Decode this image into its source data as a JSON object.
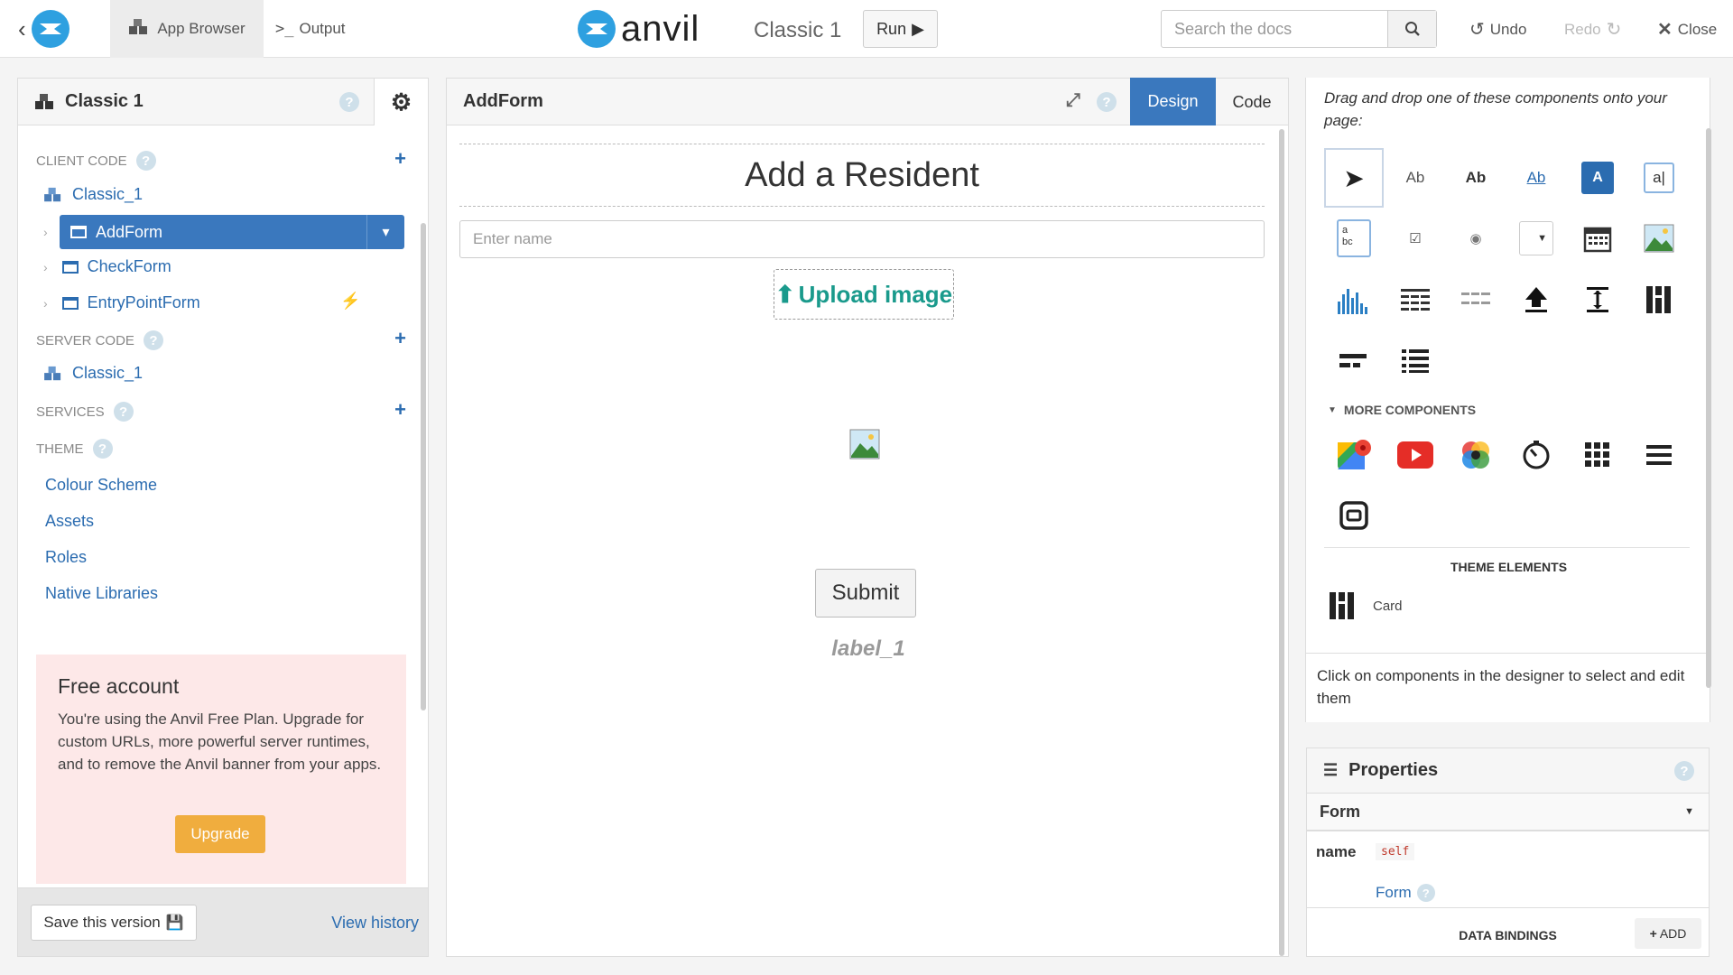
{
  "topbar": {
    "app_browser": "App Browser",
    "output": "Output",
    "brand": "anvil",
    "app_title": "Classic 1",
    "run": "Run",
    "search_placeholder": "Search the docs",
    "undo": "Undo",
    "redo": "Redo",
    "close": "Close"
  },
  "left": {
    "title": "Classic 1",
    "client_code": "CLIENT CODE",
    "client_module": "Classic_1",
    "forms": [
      "AddForm",
      "CheckForm",
      "EntryPointForm"
    ],
    "server_code": "SERVER CODE",
    "server_module": "Classic_1",
    "services": "SERVICES",
    "theme": "THEME",
    "theme_items": [
      "Colour Scheme",
      "Assets",
      "Roles",
      "Native Libraries"
    ],
    "free_title": "Free account",
    "free_text": "You're using the Anvil Free Plan. Upgrade for custom URLs, more powerful server runtimes, and to remove the Anvil banner from your apps.",
    "upgrade": "Upgrade",
    "save_version": "Save this version",
    "view_history": "View history"
  },
  "center": {
    "form_name": "AddForm",
    "tab_design": "Design",
    "tab_code": "Code",
    "heading": "Add a Resident",
    "name_placeholder": "Enter name",
    "upload": "Upload image",
    "submit": "Submit",
    "label": "label_1"
  },
  "right": {
    "instructions": "Drag and drop one of these components onto your page:",
    "more_components": "MORE COMPONENTS",
    "theme_elements": "THEME ELEMENTS",
    "card": "Card",
    "click_hint": "Click on components in the designer to select and edit them",
    "properties": "Properties",
    "form_select": "Form",
    "name_label": "name",
    "name_value": "self",
    "form_link": "Form",
    "data_bindings": "DATA BINDINGS",
    "add": "ADD"
  },
  "colors": {
    "accent": "#3a78be",
    "link": "#2b6cb0",
    "upload_teal": "#1a9a8c",
    "upgrade": "#f0ad3e",
    "free_bg": "#fde8e8"
  }
}
